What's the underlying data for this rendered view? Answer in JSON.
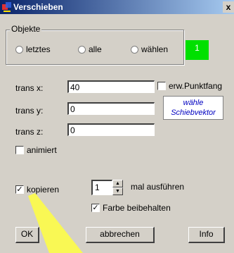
{
  "window": {
    "title": "Verschieben",
    "close_label": "x"
  },
  "objects_group": {
    "legend": "Objekte",
    "radios": [
      {
        "label": "letztes"
      },
      {
        "label": "alle"
      },
      {
        "label": "wählen"
      }
    ],
    "count": "1",
    "count_color": "#00e000"
  },
  "translation": {
    "x_label": "trans x:",
    "x_value": "40",
    "y_label": "trans y:",
    "y_value": "0",
    "z_label": "trans z:",
    "z_value": "0"
  },
  "snap_checkbox": {
    "label": "erw.Punktfang",
    "checked": false
  },
  "vector_button": {
    "line1": "wähle",
    "line2": "Schiebvektor"
  },
  "animate_checkbox": {
    "label": "animiert",
    "checked": false
  },
  "copy_checkbox": {
    "label": "kopieren",
    "checked": true
  },
  "repeat": {
    "value": "1",
    "label": "mal ausführen"
  },
  "keep_color_checkbox": {
    "label": "Farbe beibehalten",
    "checked": true
  },
  "buttons": {
    "ok": "OK",
    "cancel": "abbrechen",
    "info": "Info"
  }
}
